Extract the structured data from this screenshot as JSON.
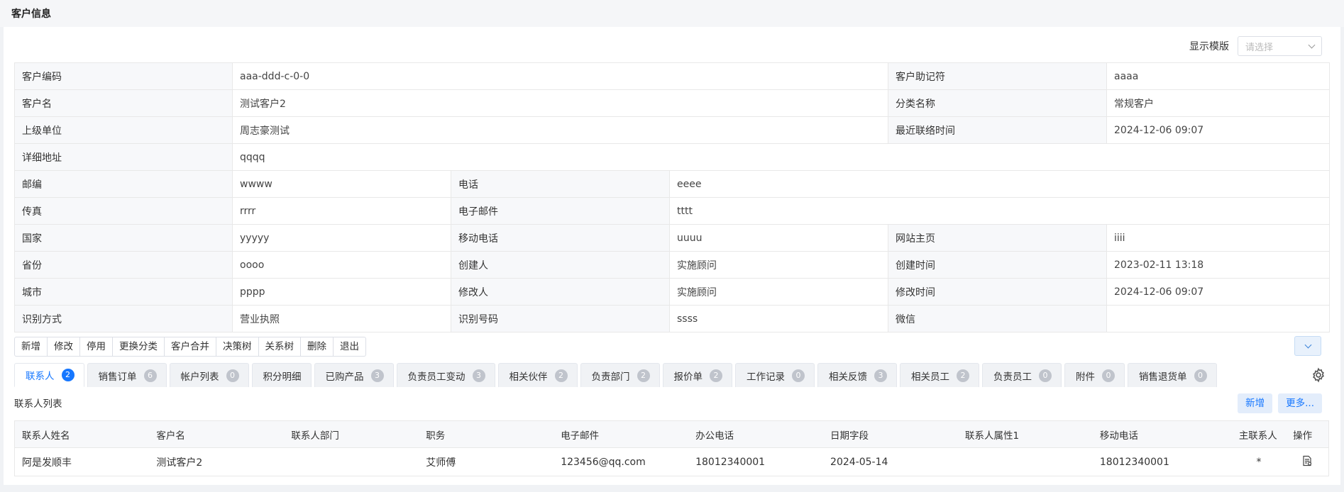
{
  "page_title": "客户信息",
  "template": {
    "label": "显示模版",
    "placeholder": "请选择"
  },
  "info_rows": [
    [
      [
        "客户编码",
        "aaa-ddd-c-0-0"
      ],
      [
        "客户助记符",
        "aaaa"
      ]
    ],
    [
      [
        "客户名",
        "测试客户2"
      ],
      [
        "分类名称",
        "常规客户"
      ]
    ],
    [
      [
        "上级单位",
        "周志豪测试"
      ],
      [
        "最近联络时间",
        "2024-12-06 09:07"
      ]
    ],
    [
      [
        "详细地址",
        "qqqq"
      ]
    ],
    [
      [
        "邮编",
        "wwww"
      ],
      [
        "电话",
        "eeee"
      ]
    ],
    [
      [
        "传真",
        "rrrr"
      ],
      [
        "电子邮件",
        "tttt"
      ]
    ],
    [
      [
        "国家",
        "yyyyy"
      ],
      [
        "移动电话",
        "uuuu"
      ],
      [
        "网站主页",
        "iiii"
      ]
    ],
    [
      [
        "省份",
        "oooo"
      ],
      [
        "创建人",
        "实施顾问"
      ],
      [
        "创建时间",
        "2023-02-11 13:18"
      ]
    ],
    [
      [
        "城市",
        "pppp"
      ],
      [
        "修改人",
        "实施顾问"
      ],
      [
        "修改时间",
        "2024-12-06 09:07"
      ]
    ],
    [
      [
        "识别方式",
        "营业执照"
      ],
      [
        "识别号码",
        "ssss"
      ],
      [
        "微信",
        ""
      ]
    ]
  ],
  "actions": [
    "新增",
    "修改",
    "停用",
    "更换分类",
    "客户合并",
    "决策树",
    "关系树",
    "删除",
    "退出"
  ],
  "tabs": [
    {
      "label": "联系人",
      "count": "2",
      "active": true
    },
    {
      "label": "销售订单",
      "count": "6"
    },
    {
      "label": "帐户列表",
      "count": "0"
    },
    {
      "label": "积分明细",
      "count": ""
    },
    {
      "label": "已购产品",
      "count": "3"
    },
    {
      "label": "负责员工变动",
      "count": "3"
    },
    {
      "label": "相关伙伴",
      "count": "2"
    },
    {
      "label": "负责部门",
      "count": "2"
    },
    {
      "label": "报价单",
      "count": "2"
    },
    {
      "label": "工作记录",
      "count": "0"
    },
    {
      "label": "相关反馈",
      "count": "3"
    },
    {
      "label": "相关员工",
      "count": "2"
    },
    {
      "label": "负责员工",
      "count": "0"
    },
    {
      "label": "附件",
      "count": "0"
    },
    {
      "label": "销售退货单",
      "count": "0"
    }
  ],
  "contacts": {
    "title": "联系人列表",
    "add_label": "新增",
    "more_label": "更多...",
    "columns": [
      "联系人姓名",
      "客户名",
      "联系人部门",
      "职务",
      "电子邮件",
      "办公电话",
      "日期字段",
      "联系人属性1",
      "移动电话",
      "主联系人",
      "操作"
    ],
    "rows": [
      [
        "阿是发顺丰",
        "测试客户2",
        "",
        "艾师傅",
        "123456@qq.com",
        "18012340001",
        "2024-05-14",
        "",
        "18012340001",
        "*",
        ""
      ]
    ]
  }
}
